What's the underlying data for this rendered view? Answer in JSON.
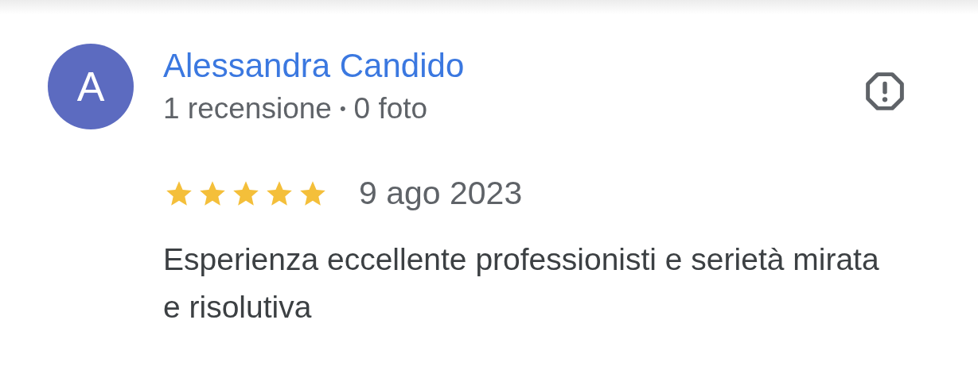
{
  "review": {
    "avatar_letter": "A",
    "author": "Alessandra Candido",
    "reviews_count": "1 recensione",
    "separator": "•",
    "photos_count": "0 foto",
    "stars": 5,
    "date": "9 ago 2023",
    "text": "Esperienza eccellente professionisti e serietà mirata e risolutiva"
  }
}
